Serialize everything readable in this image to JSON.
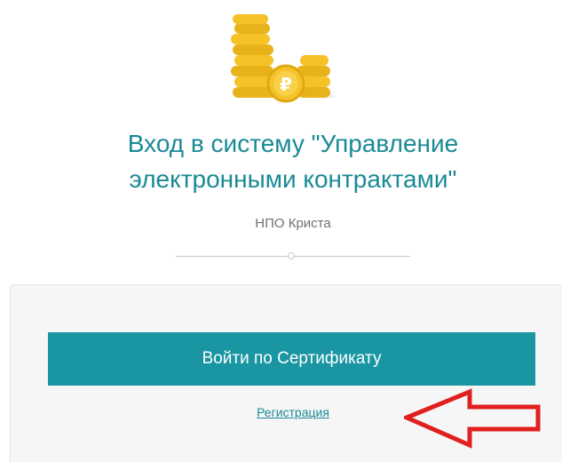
{
  "header": {
    "logo_icon": "coins-ruble-icon",
    "title_line1": "Вход в систему \"Управление",
    "title_line2": "электронными контрактами\"",
    "subtitle": "НПО Криста"
  },
  "login": {
    "certificate_button_label": "Войти по Сертификату",
    "register_link_label": "Регистрация"
  },
  "annotation": {
    "arrow_icon": "red-arrow-left-icon",
    "arrow_color": "#e0201f"
  },
  "colors": {
    "accent": "#1a96a3",
    "title": "#1a8a96",
    "coin_gold": "#f5c228"
  }
}
